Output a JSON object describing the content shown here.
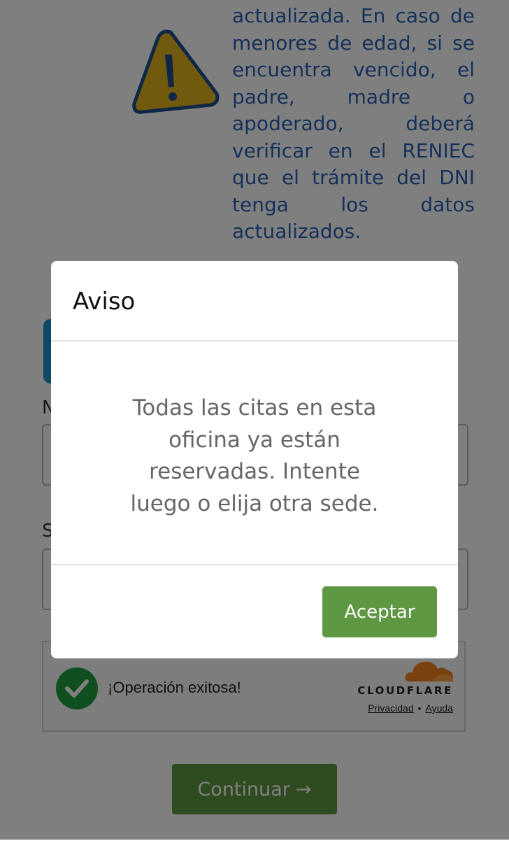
{
  "notice": {
    "text": "actualizada. En caso de menores de edad, si se encuentra vencido, el padre, madre o apoderado, deberá verificar en el RENIEC que el trámite del DNI tenga los datos actualizados."
  },
  "form": {
    "label_1": "N",
    "label_2": "S"
  },
  "captcha": {
    "status_text": "¡Operación exitosa!",
    "brand": "CLOUDFLARE",
    "privacy_link": "Privacidad",
    "separator": "•",
    "help_link": "Ayuda"
  },
  "continue_button": {
    "label": "Continuar",
    "arrow": "→"
  },
  "modal": {
    "title": "Aviso",
    "message": "Todas las citas en esta oficina ya están reservadas. Intente luego o elija otra sede.",
    "accept_label": "Aceptar"
  },
  "colors": {
    "accent_green": "#5f9843",
    "notice_blue": "#2a63b5",
    "success_green": "#1e9e3e",
    "cloudflare_orange": "#f38020",
    "overlay": "rgba(0,0,0,0.5)"
  }
}
